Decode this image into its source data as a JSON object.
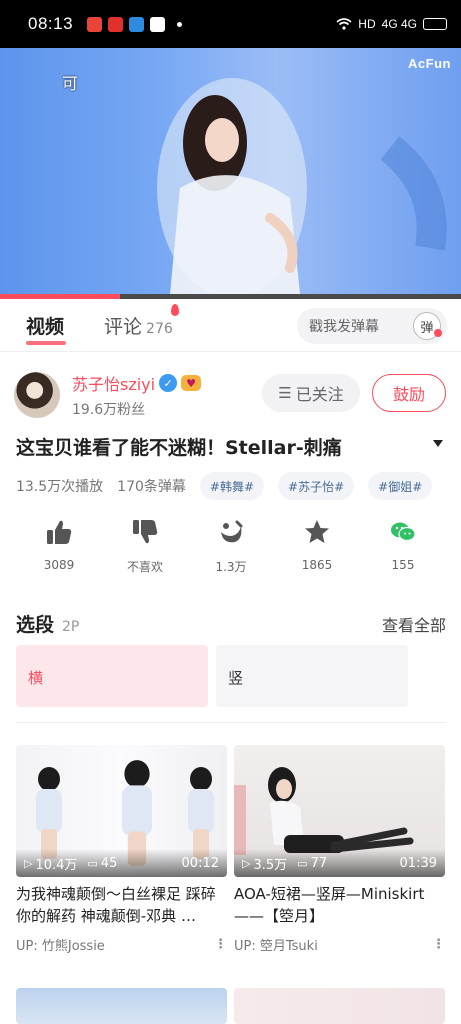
{
  "status_bar": {
    "time": "08:13",
    "network": "HD",
    "signal": "4G 4G",
    "app_colors": [
      "#e8443a",
      "#e0312e",
      "#2f8bde",
      "#ea3b3b"
    ]
  },
  "video": {
    "watermark": "AcFun",
    "danmaku_text": "可",
    "progress": 0.26,
    "accent_color": "#fd4c5c"
  },
  "tabs": [
    {
      "label": "视频"
    },
    {
      "label": "评论",
      "count": "276"
    }
  ],
  "danmaku_input": {
    "placeholder": "戳我发弹幕",
    "toggle_label": "弹"
  },
  "uploader": {
    "name": "苏子怡sziyi",
    "fans": "19.6万粉丝",
    "follow_label": "已关注",
    "encourage_label": "鼓励"
  },
  "title": "这宝贝谁看了能不迷糊！Stellar-刺痛",
  "meta": {
    "plays": "13.5万次播放",
    "danmaku_count": "170条弹幕",
    "tags": [
      "#韩舞#",
      "#苏子怡#",
      "#御姐#"
    ]
  },
  "actions": [
    {
      "icon": "thumbs-up-icon",
      "count": "3089"
    },
    {
      "icon": "thumbs-down-icon",
      "count": "不喜欢"
    },
    {
      "icon": "banana-icon",
      "count": "1.3万"
    },
    {
      "icon": "star-icon",
      "count": "1865"
    },
    {
      "icon": "wechat-icon",
      "count": "155"
    }
  ],
  "episodes": {
    "title": "选段",
    "count": "2P",
    "more_label": "查看全部",
    "items": [
      "横",
      "竖"
    ]
  },
  "recommendations": [
    {
      "plays": "10.4万",
      "comments": "45",
      "duration": "00:12",
      "title": "为我神魂颠倒～白丝裸足 踩碎你的解药 神魂颠倒-邓典 …",
      "uploader": "UP: 竹熊Jossie"
    },
    {
      "plays": "3.5万",
      "comments": "77",
      "duration": "01:39",
      "title": "AOA-短裙—竖屏—Miniskirt ——【箜月】",
      "uploader": "UP: 箜月Tsuki"
    }
  ]
}
